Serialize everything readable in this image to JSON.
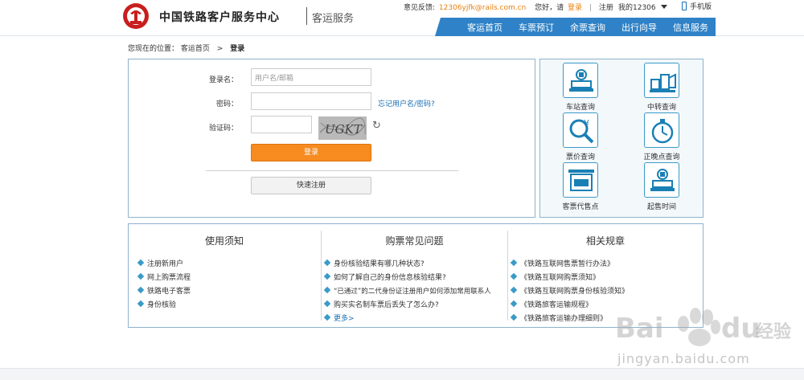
{
  "header": {
    "brand": "中国铁路客户服务中心",
    "subbrand": "客运服务",
    "feedback_label": "意见反馈:",
    "feedback_email": "12306yjfk@rails.com.cn",
    "greeting": "您好，请",
    "login_link": "登录",
    "separator": "|",
    "register_link": "注册",
    "my12306": "我的12306",
    "mobile": "手机版"
  },
  "nav": {
    "items": [
      "客运首页",
      "车票预订",
      "余票查询",
      "出行向导",
      "信息服务"
    ]
  },
  "breadcrumb": {
    "prefix": "您现在的位置：",
    "home": "客运首页",
    "sep": ">",
    "current": "登录"
  },
  "login": {
    "username_label": "登录名：",
    "username_placeholder": "用户名/邮箱",
    "password_label": "密码：",
    "forgot": "忘记用户名/密码?",
    "captcha_label": "验证码：",
    "captcha_text": "UGKT",
    "login_button": "登录",
    "register_button": "快速注册"
  },
  "services": [
    {
      "label": "车站查询",
      "icon": "station-icon"
    },
    {
      "label": "中转查询",
      "icon": "transfer-icon"
    },
    {
      "label": "票价查询",
      "icon": "fare-icon"
    },
    {
      "label": "正晚点查询",
      "icon": "clock-icon"
    },
    {
      "label": "客票代售点",
      "icon": "ticket-agent-icon"
    },
    {
      "label": "起售时间",
      "icon": "sale-time-icon"
    }
  ],
  "info": {
    "col1": {
      "title": "使用须知",
      "items": [
        "注册新用户",
        "网上购票流程",
        "铁路电子客票",
        "身份核验"
      ]
    },
    "col2": {
      "title": "购票常见问题",
      "items": [
        "身份核验结果有哪几种状态?",
        "如何了解自己的身份信息核验结果?",
        "“已通过”的二代身份证注册用户如何添加常用联系人",
        "购买实名制车票后丢失了怎么办?"
      ],
      "more": "更多>"
    },
    "col3": {
      "title": "相关规章",
      "items": [
        "《铁路互联网售票暂行办法》",
        "《铁路互联网购票须知》",
        "《铁路互联网购票身份核验须知》",
        "《铁路旅客运输规程》",
        "《铁路旅客运输办理细则》"
      ]
    }
  },
  "watermark": {
    "brand": "Bai",
    "brand2": "du",
    "cn": "经验",
    "url": "jingyan.baidu.com"
  },
  "colors": {
    "nav_blue": "#2f82c7",
    "login_orange": "#f78b1f",
    "link_blue": "#1a6fb5",
    "border_blue": "#8fb2cc"
  }
}
